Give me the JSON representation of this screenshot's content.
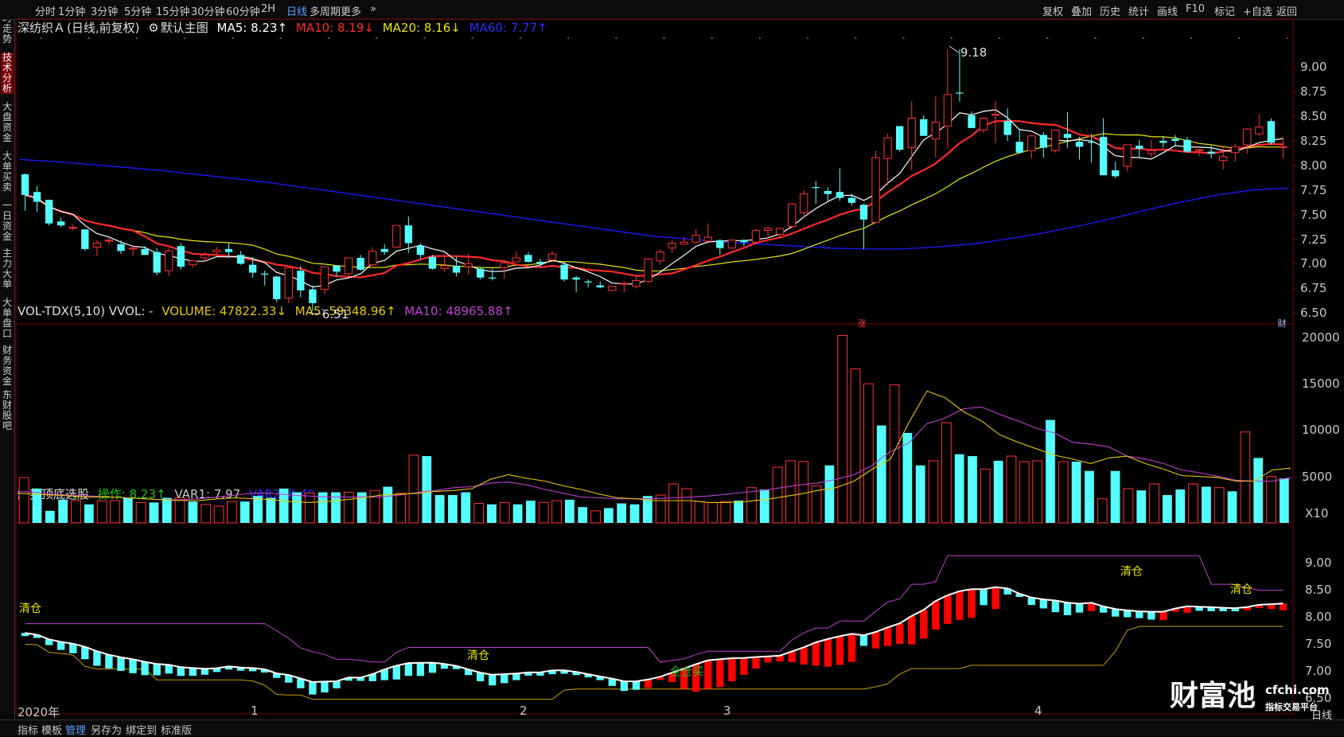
{
  "topbar": {
    "periods": [
      {
        "label": "分时"
      },
      {
        "label": "1分钟"
      },
      {
        "label": "3分钟"
      },
      {
        "label": "5分钟"
      },
      {
        "label": "15分钟"
      },
      {
        "label": "30分钟"
      },
      {
        "label": "60分钟"
      },
      {
        "label": "2H"
      },
      {
        "label": "日线",
        "active": true
      },
      {
        "label": "多周期"
      },
      {
        "label": "更多"
      }
    ],
    "more_arrow": "»",
    "right_buttons": [
      {
        "label": "复权"
      },
      {
        "label": "叠加"
      },
      {
        "label": "历史"
      },
      {
        "label": "统计"
      },
      {
        "label": "画线"
      },
      {
        "label": "F10"
      },
      {
        "label": "标记"
      },
      {
        "label": "+自选"
      },
      {
        "label": "返回"
      }
    ]
  },
  "sidebar": {
    "tabs": [
      {
        "label": "分时走势"
      },
      {
        "label": "技术分析",
        "active": true
      },
      {
        "label": "大盘资金"
      },
      {
        "label": "大单买卖"
      },
      {
        "label": "一日资金"
      },
      {
        "label": "主力大单"
      },
      {
        "label": "大单盘口"
      },
      {
        "label": "财务资金"
      },
      {
        "label": "东财股吧"
      }
    ]
  },
  "main_chart": {
    "stock_name": "深纺织Ａ",
    "period_desc": "(日线,前复权)",
    "indicator_icon": "gear-icon",
    "indicator_name": "默认主图",
    "ma5": "MA5: 8.23↑",
    "ma10": "MA10: 8.19↓",
    "ma20": "MA20: 8.16↓",
    "ma60": "MA60: 7.77↑",
    "colors": {
      "ma5": "#ffffff",
      "ma10": "#ff2a2a",
      "ma20": "#e6e600",
      "ma60": "#1a1aff",
      "up": "#ff3232",
      "down": "#54ffff"
    },
    "high_label": "9.18",
    "low_label": "6.51",
    "event_zhang": "涨",
    "event_cai": "财",
    "y_ticks": [
      "9.00",
      "8.75",
      "8.50",
      "8.25",
      "8.00",
      "7.75",
      "7.50",
      "7.25",
      "7.00",
      "6.75",
      "6.50"
    ],
    "candles": [
      [
        7.91,
        7.92,
        7.54,
        7.7
      ],
      [
        7.73,
        7.79,
        7.53,
        7.63
      ],
      [
        7.65,
        7.65,
        7.39,
        7.41
      ],
      [
        7.43,
        7.47,
        7.37,
        7.39
      ],
      [
        7.37,
        7.4,
        7.34,
        7.37
      ],
      [
        7.35,
        7.35,
        7.13,
        7.15
      ],
      [
        7.17,
        7.24,
        7.08,
        7.21
      ],
      [
        7.23,
        7.26,
        7.19,
        7.24
      ],
      [
        7.2,
        7.24,
        7.1,
        7.13
      ],
      [
        7.15,
        7.18,
        7.08,
        7.16
      ],
      [
        7.15,
        7.18,
        7.09,
        7.09
      ],
      [
        7.12,
        7.16,
        6.88,
        6.91
      ],
      [
        6.93,
        7.16,
        6.88,
        7.13
      ],
      [
        7.18,
        7.21,
        6.94,
        6.97
      ],
      [
        6.99,
        7.04,
        6.96,
        7.03
      ],
      [
        7.06,
        7.12,
        7.02,
        7.09
      ],
      [
        7.12,
        7.17,
        7.1,
        7.14
      ],
      [
        7.15,
        7.21,
        7.06,
        7.12
      ],
      [
        7.09,
        7.13,
        6.99,
        7.0
      ],
      [
        6.99,
        7.07,
        6.86,
        6.91
      ],
      [
        6.9,
        6.93,
        6.78,
        6.89
      ],
      [
        6.87,
        6.88,
        6.61,
        6.64
      ],
      [
        6.65,
        6.96,
        6.6,
        6.96
      ],
      [
        6.93,
        6.98,
        6.66,
        6.73
      ],
      [
        6.74,
        6.78,
        6.52,
        6.6
      ],
      [
        6.74,
        6.97,
        6.69,
        6.97
      ],
      [
        6.98,
        6.98,
        6.87,
        6.92
      ],
      [
        6.9,
        7.06,
        6.87,
        7.06
      ],
      [
        7.06,
        7.09,
        6.93,
        6.94
      ],
      [
        6.99,
        7.17,
        6.96,
        7.13
      ],
      [
        7.15,
        7.2,
        7.09,
        7.12
      ],
      [
        7.17,
        7.39,
        7.17,
        7.39
      ],
      [
        7.39,
        7.48,
        7.11,
        7.21
      ],
      [
        7.18,
        7.21,
        7.05,
        7.09
      ],
      [
        7.07,
        7.09,
        6.94,
        6.95
      ],
      [
        6.95,
        7.08,
        6.92,
        6.98
      ],
      [
        6.98,
        7.07,
        6.87,
        6.91
      ],
      [
        6.97,
        7.1,
        6.89,
        7.0
      ],
      [
        6.95,
        6.97,
        6.84,
        6.86
      ],
      [
        6.86,
        6.95,
        6.83,
        6.85
      ],
      [
        6.96,
        7.04,
        6.85,
        7.01
      ],
      [
        7.02,
        7.13,
        7.02,
        7.06
      ],
      [
        7.09,
        7.12,
        7.01,
        7.02
      ],
      [
        7.02,
        7.05,
        6.97,
        7.0
      ],
      [
        7.04,
        7.13,
        7.03,
        7.1
      ],
      [
        6.99,
        7.02,
        6.82,
        6.84
      ],
      [
        6.86,
        6.88,
        6.71,
        6.84
      ],
      [
        6.82,
        6.84,
        6.76,
        6.81
      ],
      [
        6.78,
        6.82,
        6.75,
        6.76
      ],
      [
        6.73,
        6.77,
        6.72,
        6.77
      ],
      [
        6.8,
        6.82,
        6.71,
        6.8
      ],
      [
        6.77,
        6.89,
        6.75,
        6.83
      ],
      [
        6.82,
        7.06,
        6.81,
        7.05
      ],
      [
        7.03,
        7.15,
        6.99,
        7.12
      ],
      [
        7.16,
        7.24,
        7.11,
        7.21
      ],
      [
        7.2,
        7.27,
        7.19,
        7.22
      ],
      [
        7.22,
        7.35,
        7.21,
        7.29
      ],
      [
        7.23,
        7.41,
        7.23,
        7.27
      ],
      [
        7.24,
        7.25,
        7.09,
        7.16
      ],
      [
        7.16,
        7.25,
        7.15,
        7.24
      ],
      [
        7.24,
        7.25,
        7.18,
        7.22
      ],
      [
        7.22,
        7.35,
        7.2,
        7.34
      ],
      [
        7.34,
        7.38,
        7.28,
        7.36
      ],
      [
        7.3,
        7.37,
        7.26,
        7.36
      ],
      [
        7.38,
        7.62,
        7.36,
        7.61
      ],
      [
        7.52,
        7.75,
        7.46,
        7.71
      ],
      [
        7.78,
        7.84,
        7.61,
        7.77
      ],
      [
        7.74,
        7.78,
        7.64,
        7.71
      ],
      [
        7.73,
        7.97,
        7.64,
        7.67
      ],
      [
        7.67,
        7.71,
        7.59,
        7.62
      ],
      [
        7.6,
        7.61,
        7.15,
        7.45
      ],
      [
        7.42,
        8.15,
        7.41,
        8.08
      ],
      [
        8.07,
        8.32,
        7.8,
        8.28
      ],
      [
        8.4,
        8.38,
        8.14,
        8.16
      ],
      [
        8.18,
        8.65,
        7.95,
        8.48
      ],
      [
        8.47,
        8.51,
        8.31,
        8.3
      ],
      [
        8.27,
        8.7,
        8.08,
        8.44
      ],
      [
        8.4,
        9.18,
        8.18,
        8.72
      ],
      [
        8.74,
        9.18,
        8.65,
        8.73
      ],
      [
        8.51,
        8.55,
        8.38,
        8.38
      ],
      [
        8.36,
        8.49,
        8.33,
        8.48
      ],
      [
        8.52,
        8.65,
        8.23,
        8.52
      ],
      [
        8.45,
        8.58,
        8.25,
        8.31
      ],
      [
        8.24,
        8.36,
        8.12,
        8.13
      ],
      [
        8.15,
        8.31,
        8.07,
        8.3
      ],
      [
        8.31,
        8.34,
        8.08,
        8.18
      ],
      [
        8.15,
        8.35,
        8.13,
        8.36
      ],
      [
        8.32,
        8.54,
        8.18,
        8.28
      ],
      [
        8.24,
        8.29,
        8.06,
        8.19
      ],
      [
        8.24,
        8.32,
        8.03,
        8.23
      ],
      [
        8.29,
        8.48,
        7.9,
        7.9
      ],
      [
        7.95,
        8.04,
        7.87,
        7.89
      ],
      [
        7.99,
        8.12,
        7.94,
        8.21
      ],
      [
        8.2,
        8.26,
        8.08,
        8.17
      ],
      [
        8.12,
        8.26,
        8.08,
        8.15
      ],
      [
        8.25,
        8.3,
        8.18,
        8.23
      ],
      [
        8.27,
        8.31,
        8.19,
        8.25
      ],
      [
        8.26,
        8.29,
        8.13,
        8.14
      ],
      [
        8.15,
        8.17,
        8.09,
        8.16
      ],
      [
        8.14,
        8.2,
        8.07,
        8.12
      ],
      [
        8.05,
        8.2,
        7.96,
        8.09
      ],
      [
        8.13,
        8.22,
        8.04,
        8.19
      ],
      [
        8.21,
        8.38,
        8.12,
        8.37
      ],
      [
        8.32,
        8.52,
        8.3,
        8.39
      ],
      [
        8.45,
        8.48,
        8.21,
        8.23
      ],
      [
        8.19,
        8.29,
        8.07,
        8.19
      ]
    ],
    "ma60_line": [
      8.06,
      8.04,
      8.01,
      7.98,
      7.95,
      7.91,
      7.87,
      7.83,
      7.78,
      7.73,
      7.68,
      7.63,
      7.58,
      7.53,
      7.48,
      7.43,
      7.38,
      7.33,
      7.28,
      7.25,
      7.22,
      7.2,
      7.18,
      7.16,
      7.15,
      7.15,
      7.17,
      7.2,
      7.25,
      7.31,
      7.38,
      7.46,
      7.55,
      7.63,
      7.7,
      7.75,
      7.77
    ]
  },
  "volume_chart": {
    "legend_name": "VOL-TDX(5,10) VVOL: -",
    "volume": "VOLUME: 47822.33↓",
    "ma5": "MA5: 59348.96↑",
    "ma10": "MA10: 48965.88↑",
    "colors": {
      "volume": "#e6c800",
      "ma5": "#e6c800",
      "ma10": "#c040d0"
    },
    "y_ticks": [
      "20000",
      "15000",
      "10000",
      "5000"
    ],
    "unit": "X10",
    "bars": [
      4900,
      3700,
      1300,
      2500,
      2400,
      2000,
      2400,
      2400,
      2700,
      2200,
      2200,
      2700,
      2700,
      2300,
      2000,
      1800,
      2300,
      2300,
      2900,
      2700,
      3700,
      3300,
      3200,
      3300,
      3300,
      3300,
      3300,
      3500,
      3900,
      3200,
      7300,
      7200,
      3000,
      3000,
      3300,
      2100,
      2000,
      2200,
      2000,
      2400,
      2200,
      2400,
      2500,
      1700,
      1300,
      1600,
      2100,
      2000,
      2900,
      3000,
      4200,
      3700,
      2300,
      2200,
      2300,
      2400,
      3800,
      3600,
      6000,
      6700,
      6600,
      4000,
      6200,
      20200,
      16600,
      15000,
      10500,
      14900,
      9700,
      6200,
      6700,
      10800,
      7400,
      7200,
      5800,
      6700,
      7200,
      6600,
      6700,
      11100,
      6600,
      6600,
      5600,
      2600,
      5600,
      3700,
      3500,
      4200,
      3000,
      3600,
      4200,
      3900,
      3800,
      3400,
      9800,
      7000,
      5000,
      4800
    ],
    "bar_up": [
      1,
      0,
      0,
      0,
      1,
      0,
      1,
      1,
      0,
      1,
      0,
      0,
      1,
      0,
      1,
      1,
      1,
      0,
      0,
      0,
      0,
      0,
      1,
      0,
      0,
      1,
      0,
      1,
      0,
      1,
      1,
      0,
      0,
      0,
      0,
      1,
      0,
      1,
      0,
      0,
      1,
      1,
      0,
      0,
      1,
      0,
      0,
      0,
      0,
      1,
      1,
      1,
      1,
      1,
      1,
      0,
      1,
      0,
      1,
      1,
      1,
      1,
      0,
      1,
      1,
      1,
      0,
      1,
      0,
      0,
      1,
      1,
      0,
      0,
      1,
      0,
      1,
      1,
      1,
      0,
      1,
      0,
      0,
      1,
      0,
      1,
      0,
      1,
      0,
      0,
      1,
      0,
      1,
      0,
      1,
      0,
      1,
      0
    ],
    "vma5_line": [
      3200,
      3100,
      3000,
      2900,
      2800,
      2800,
      2700,
      2600,
      2500,
      2400,
      2400,
      2600,
      2700,
      2600,
      2500,
      2300,
      2200,
      2300,
      2500,
      2700,
      3000,
      3100,
      3200,
      3400,
      3500,
      3700,
      4700,
      5200,
      4800,
      4500,
      4000,
      3600,
      3100,
      2700,
      2600,
      2400,
      2400,
      2400,
      2200,
      2200,
      2300,
      2500,
      2800,
      3100,
      3500,
      3800,
      4500,
      5800,
      6900,
      10800,
      14200,
      13500,
      12000,
      11000,
      9500,
      8700,
      8000,
      7300,
      6900,
      6400,
      7000,
      7200,
      6400,
      5800,
      5100,
      5000,
      4900,
      4500,
      4500,
      5700,
      5900
    ],
    "vma10_line": [
      3400,
      3300,
      3100,
      3000,
      2900,
      2800,
      2700,
      2600,
      2500,
      2500,
      2600,
      2800,
      3000,
      3200,
      3200,
      3000,
      2900,
      2800,
      2800,
      2800,
      2800,
      3000,
      3300,
      3500,
      3800,
      3900,
      4300,
      4400,
      4100,
      3600,
      3200,
      2800,
      2700,
      2600,
      2600,
      2600,
      2700,
      2800,
      2900,
      3100,
      3300,
      3500,
      3800,
      4100,
      4300,
      4700,
      5200,
      6200,
      7700,
      8600,
      10700,
      11300,
      12300,
      12500,
      11700,
      11000,
      10200,
      9700,
      8700,
      8500,
      8200,
      7200,
      6900,
      6400,
      5700,
      5400,
      5000,
      4600,
      4500,
      4500,
      4900
    ]
  },
  "indicator_chart": {
    "legend_name": "趋势顶底选股",
    "op": "操作: 8.23↑",
    "var1": "VAR1: 7.97",
    "var2": "VAR2: 8.40",
    "colors": {
      "op": "#1cc31c",
      "var1": "#c8c8c8",
      "var2": "#2020ff",
      "upper": "#c040d0",
      "lower": "#c8a000",
      "mid": "#ffffff",
      "buy": "#ff0000",
      "sell": "#54ffff",
      "signal": "#e6e600"
    },
    "y_ticks": [
      "9.00",
      "8.50",
      "8.00",
      "7.50",
      "7.00",
      "6.50"
    ],
    "signals": [
      {
        "text": "清仓",
        "col": "yellow"
      },
      {
        "text": "清仓",
        "col": "yellow"
      },
      {
        "text": "全仓买",
        "col": "green"
      },
      {
        "text": "清仓",
        "col": "yellow"
      },
      {
        "text": "清仓",
        "col": "yellow"
      }
    ]
  },
  "date_axis": [
    "2020年",
    "1",
    "2",
    "3",
    "4"
  ],
  "bottombar": {
    "items": [
      {
        "label": "指标"
      },
      {
        "label": "模板"
      },
      {
        "label": "管理",
        "active": true
      },
      {
        "label": "另存为"
      },
      {
        "label": "绑定到"
      },
      {
        "label": "标准版"
      }
    ]
  },
  "side_panel": {
    "label": "日线"
  },
  "watermark": {
    "brand": "财富池",
    "url": "cfchi.com",
    "slogan": "指标交易平台"
  }
}
